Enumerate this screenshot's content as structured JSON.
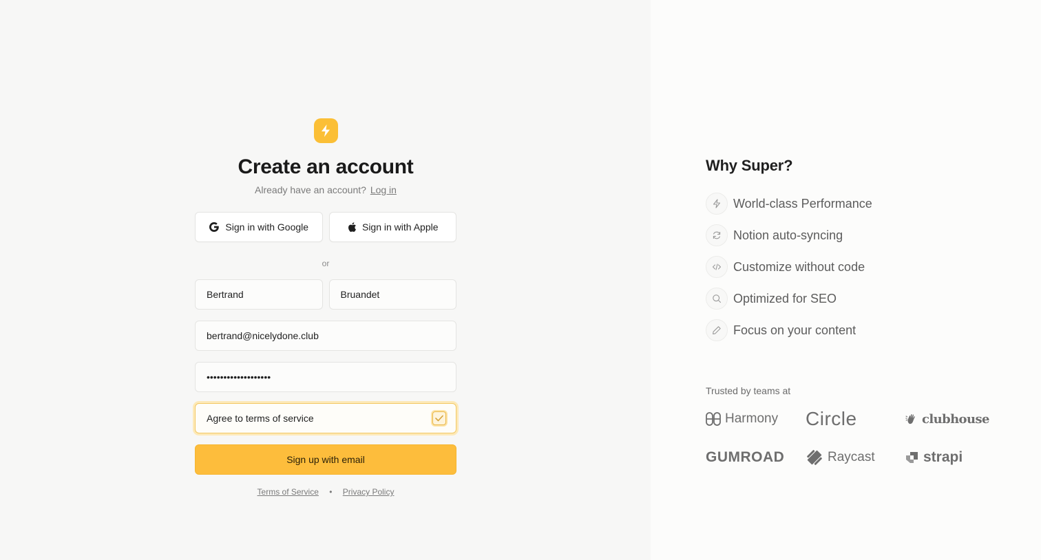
{
  "signup": {
    "title": "Create an account",
    "subtitle": "Already have an account?",
    "login_link": "Log in",
    "google_label": "Sign in with Google",
    "apple_label": "Sign in with Apple",
    "divider": "or",
    "first_name": "Bertrand",
    "last_name": "Bruandet",
    "email": "bertrand@nicelydone.club",
    "password_mask": "•••••••••••••••••••",
    "agree_label": "Agree to terms of service",
    "agree_checked": true,
    "submit_label": "Sign up with email",
    "terms_link": "Terms of Service",
    "separator": "•",
    "privacy_link": "Privacy Policy"
  },
  "why": {
    "title": "Why Super?",
    "features": [
      {
        "icon": "bolt-icon",
        "label": "World-class Performance"
      },
      {
        "icon": "sync-icon",
        "label": "Notion auto-syncing"
      },
      {
        "icon": "code-icon",
        "label": "Customize without code"
      },
      {
        "icon": "search-icon",
        "label": "Optimized for SEO"
      },
      {
        "icon": "pencil-icon",
        "label": "Focus on your content"
      }
    ]
  },
  "trusted": {
    "label": "Trusted by teams at",
    "brands": [
      "Harmony",
      "Circle",
      "clubhouse",
      "GUMROAD",
      "Raycast",
      "strapi"
    ]
  },
  "colors": {
    "accent": "#fdbd3c",
    "panel_left": "#f7f7f6",
    "panel_right": "#fcfcfb"
  }
}
